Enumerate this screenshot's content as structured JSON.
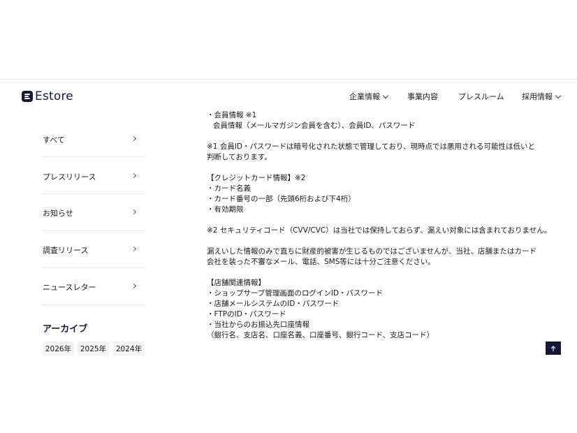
{
  "header": {
    "logo_text": "Estore",
    "nav": [
      {
        "label": "企業情報",
        "has_dropdown": true
      },
      {
        "label": "事業内容",
        "has_dropdown": false
      },
      {
        "label": "プレスルーム",
        "has_dropdown": false
      },
      {
        "label": "採用情報",
        "has_dropdown": true
      }
    ]
  },
  "sidebar": {
    "categories": [
      "すべて",
      "プレスリリース",
      "お知らせ",
      "調査リリース",
      "ニュースレター"
    ],
    "archive_heading": "アーカイブ",
    "years": [
      "2026年",
      "2025年",
      "2024年"
    ]
  },
  "article": {
    "member_item": "・会員情報 ※1",
    "member_detail": "会員情報（メールマガジン会員を含む）、会員ID、パスワード",
    "note1": "※1 会員ID・パスワードは暗号化された状態で管理しており、現時点では悪用される可能性は低いと判断しております。",
    "card_heading": "【クレジットカード情報】※2",
    "card_items": [
      "・カード名義",
      "・カード番号の一部（先頭6桁および下4桁）",
      "・有効期限"
    ],
    "note2": "※2 セキュリティコード（CVV/CVC）は当社では保持しておらず、漏えい対象には含まれておりません。",
    "warning": "漏えいした情報のみで直ちに財産的被害が生じるものではございませんが、当社、店舗またはカード会社を装った不審なメール、電話、SMS等には十分ご注意ください。",
    "store_heading": "【店舗関連情報】",
    "store_items": [
      "・ショップサーブ管理画面のログインID・パスワード",
      "・店舗メールシステムのID・パスワード",
      "・FTPのID・パスワード",
      "・当社からのお振込先口座情報"
    ],
    "store_detail": "（銀行名、支店名、口座名義、口座番号、銀行コード、支店コード）"
  },
  "icons": {
    "logo": "estore-logo-icon",
    "dropdown": "chevron-down-icon",
    "category_arrow": "chevron-right-icon",
    "scroll_top": "arrow-up-icon"
  },
  "colors": {
    "brand": "#14193a",
    "divider": "#e6e6ea",
    "chip_bg": "#f3f3f5"
  }
}
